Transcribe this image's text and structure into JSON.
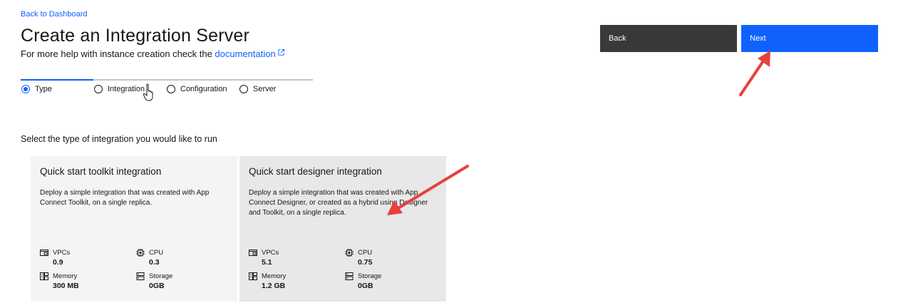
{
  "header": {
    "back_link": "Back to Dashboard",
    "title": "Create an Integration Server",
    "help_prefix": "For more help with instance creation check the ",
    "help_link": "documentation"
  },
  "actions": {
    "back_label": "Back",
    "next_label": "Next"
  },
  "progress": {
    "steps": [
      {
        "label": "Type",
        "active": true
      },
      {
        "label": "Integration",
        "active": false
      },
      {
        "label": "Configuration",
        "active": false
      },
      {
        "label": "Server",
        "active": false
      }
    ]
  },
  "main": {
    "section_label": "Select the type of integration you would like to run",
    "tiles": [
      {
        "title": "Quick start toolkit integration",
        "description": "Deploy a simple integration that was created with App Connect Toolkit, on a single replica.",
        "metrics": {
          "vpcs_label": "VPCs",
          "vpcs_value": "0.9",
          "cpu_label": "CPU",
          "cpu_value": "0.3",
          "memory_label": "Memory",
          "memory_value": "300 MB",
          "storage_label": "Storage",
          "storage_value": "0GB"
        }
      },
      {
        "title": "Quick start designer integration",
        "description": "Deploy a simple integration that was created with App Connect Designer, or created as a hybrid using Designer and Toolkit, on a single replica.",
        "metrics": {
          "vpcs_label": "VPCs",
          "vpcs_value": "5.1",
          "cpu_label": "CPU",
          "cpu_value": "0.75",
          "memory_label": "Memory",
          "memory_value": "1.2 GB",
          "storage_label": "Storage",
          "storage_value": "0GB"
        }
      }
    ]
  },
  "colors": {
    "accent": "#0f62fe",
    "back_button": "#393939",
    "annotation_arrow": "#e8403c"
  },
  "icons": [
    "external-link-icon",
    "hand-pointer-icon",
    "vpc-icon",
    "cpu-icon",
    "memory-icon",
    "storage-icon"
  ]
}
